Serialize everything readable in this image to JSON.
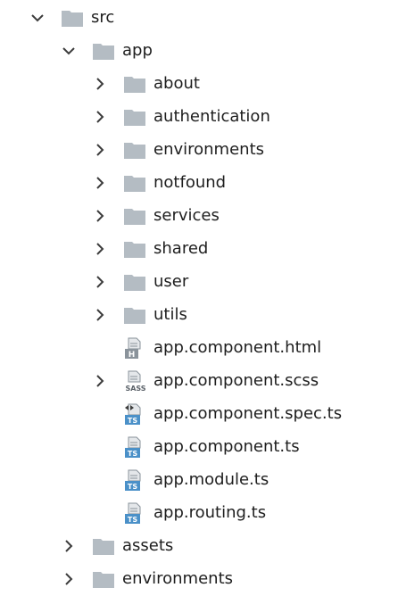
{
  "tree": {
    "src_label": "src",
    "app_label": "app",
    "items": [
      {
        "label": "about",
        "kind": "folder",
        "icon": "folder-icon"
      },
      {
        "label": "authentication",
        "kind": "folder",
        "icon": "folder-icon"
      },
      {
        "label": "environments",
        "kind": "folder",
        "icon": "folder-icon"
      },
      {
        "label": "notfound",
        "kind": "folder",
        "icon": "folder-icon"
      },
      {
        "label": "services",
        "kind": "folder",
        "icon": "folder-icon"
      },
      {
        "label": "shared",
        "kind": "folder",
        "icon": "folder-icon"
      },
      {
        "label": "user",
        "kind": "folder",
        "icon": "folder-icon"
      },
      {
        "label": "utils",
        "kind": "folder",
        "icon": "folder-icon"
      },
      {
        "label": "app.component.html",
        "kind": "file",
        "icon": "html-file-icon",
        "badge": "H"
      },
      {
        "label": "app.component.scss",
        "kind": "file",
        "icon": "sass-file-icon",
        "badge": "SASS"
      },
      {
        "label": "app.component.spec.ts",
        "kind": "file",
        "icon": "typescript-test-file-icon",
        "badge": "TS"
      },
      {
        "label": "app.component.ts",
        "kind": "file",
        "icon": "typescript-file-icon",
        "badge": "TS"
      },
      {
        "label": "app.module.ts",
        "kind": "file",
        "icon": "typescript-file-icon",
        "badge": "TS"
      },
      {
        "label": "app.routing.ts",
        "kind": "file",
        "icon": "typescript-file-icon",
        "badge": "TS"
      }
    ],
    "assets_label": "assets",
    "environments_label": "environments",
    "colors": {
      "folder": "#b4bcc3",
      "chevron": "#3c3c3c",
      "ts_badge": "#4a90c8",
      "text": "#1e1e1e"
    }
  }
}
